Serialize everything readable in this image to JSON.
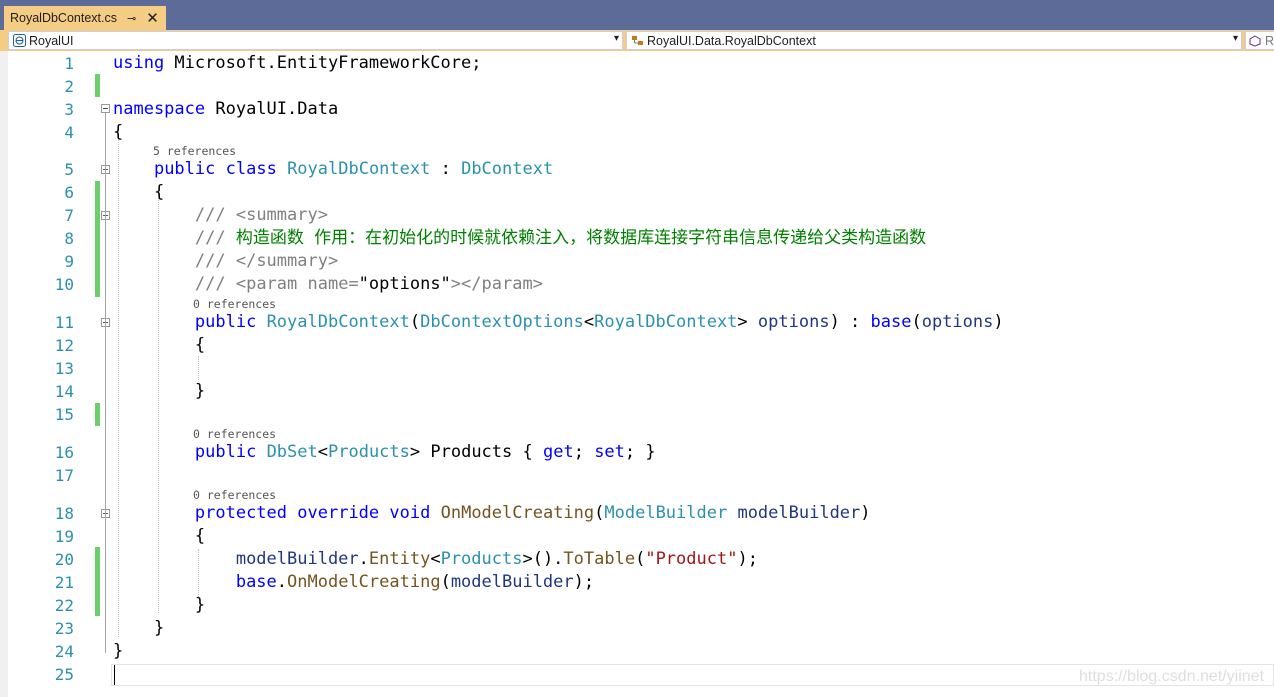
{
  "tab": {
    "title": "RoyalDbContext.cs",
    "pin": "⊸",
    "close": "✕"
  },
  "navbar": {
    "project": "RoyalUI",
    "type": "RoyalUI.Data.RoyalDbContext",
    "member": "R"
  },
  "references": {
    "class": "5 references",
    "ctor": "0 references",
    "products": "0 references",
    "onmodel": "0 references"
  },
  "code": {
    "l1": {
      "kw": "using",
      "rest": " Microsoft.EntityFrameworkCore;"
    },
    "l3": {
      "kw": "namespace",
      "rest": " RoyalUI.Data"
    },
    "l4": "{",
    "l5": {
      "kw1": "public",
      "kw2": "class",
      "name": "RoyalDbContext",
      "sep": " : ",
      "base": "DbContext"
    },
    "l6": "{",
    "l7": {
      "prefix": "/// ",
      "tag": "<summary>"
    },
    "l8": {
      "prefix": "/// ",
      "text": "构造函数 作用：在初始化的时候就依赖注入，将数据库连接字符串信息传递给父类构造函数"
    },
    "l9": {
      "prefix": "/// ",
      "tag": "</summary>"
    },
    "l10": {
      "prefix": "/// ",
      "open": "<param name=",
      "attr": "\"options\"",
      "close": "></param>"
    },
    "l11": {
      "kw": "public",
      "name": "RoyalDbContext",
      "p1": "(",
      "type": "DbContextOptions",
      "lt": "<",
      "type2": "RoyalDbContext",
      "gt": "> ",
      "param": "options",
      "p2": ") : ",
      "base": "base",
      "p3": "(",
      "arg": "options",
      "p4": ")"
    },
    "l12": "{",
    "l14": "}",
    "l16": {
      "kw": "public",
      "type": "DbSet",
      "lt": "<",
      "type2": "Products",
      "gt": "> ",
      "name": "Products",
      "ob": " { ",
      "get": "get",
      "semi1": "; ",
      "set": "set",
      "semi2": "; }"
    },
    "l18": {
      "kw1": "protected",
      "kw2": "override",
      "kw3": "void",
      "name": "OnModelCreating",
      "p1": "(",
      "type": "ModelBuilder",
      "param": " modelBuilder",
      "p2": ")"
    },
    "l19": "{",
    "l20": {
      "obj": "modelBuilder",
      "dot1": ".",
      "m1": "Entity",
      "lt": "<",
      "type": "Products",
      "gt": ">().",
      "m2": "ToTable",
      "p1": "(",
      "str": "\"Product\"",
      "p2": ");"
    },
    "l21": {
      "kw": "base",
      "dot": ".",
      "m": "OnModelCreating",
      "p1": "(",
      "arg": "modelBuilder",
      "p2": ");"
    },
    "l22": "}",
    "l23": "}",
    "l24": "}"
  },
  "line_numbers": [
    "1",
    "2",
    "3",
    "4",
    "5",
    "6",
    "7",
    "8",
    "9",
    "10",
    "11",
    "12",
    "13",
    "14",
    "15",
    "16",
    "17",
    "18",
    "19",
    "20",
    "21",
    "22",
    "23",
    "24",
    "25"
  ],
  "watermark": "https://blog.csdn.net/yiinet",
  "colors": {
    "keyword": "#0000ff",
    "type": "#2b91af",
    "comment": "#008000",
    "string": "#a31515",
    "method": "#74531f",
    "param": "#1f377f",
    "tab_active": "#f5cc84",
    "tab_strip": "#5d6b99",
    "change_bar": "#6bcf6b"
  }
}
